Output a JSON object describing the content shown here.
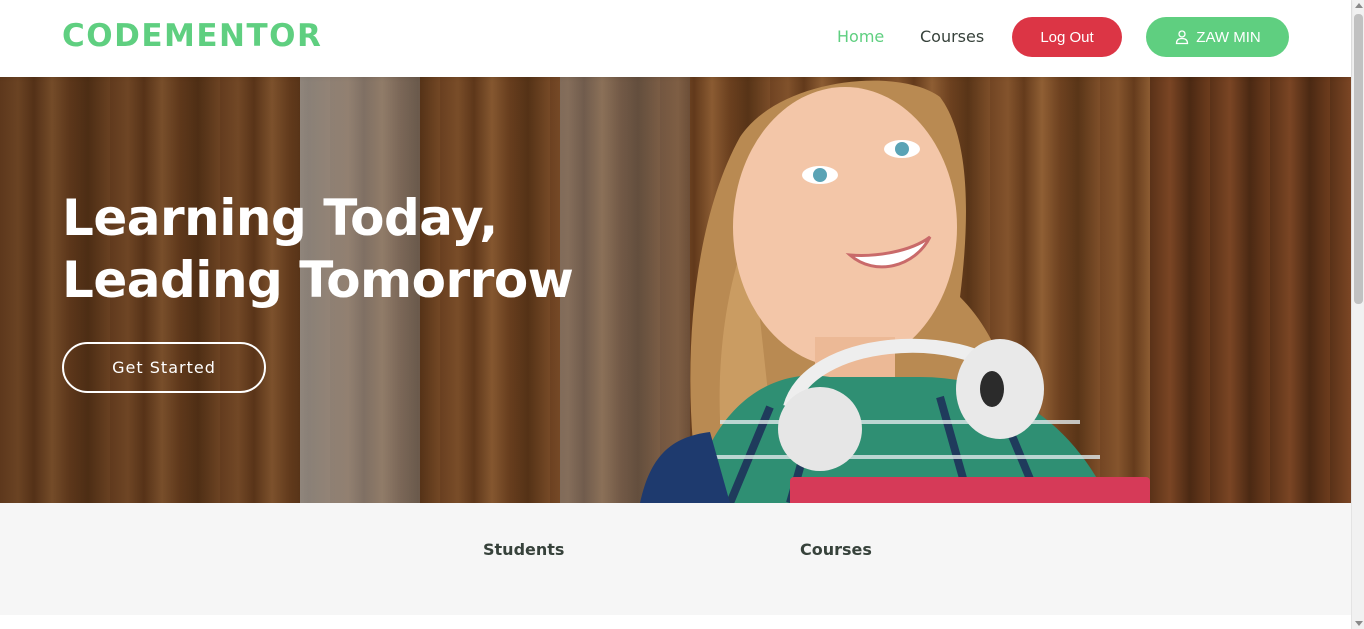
{
  "brand": {
    "name": "CODEMENTOR",
    "color": "#5fcf80"
  },
  "nav": {
    "home_label": "Home",
    "courses_label": "Courses",
    "logout_label": "Log Out",
    "user_label": "ZAW MIN",
    "user_icon": "user-icon",
    "active": "Home"
  },
  "hero": {
    "title_line1": "Learning Today,",
    "title_line2": "Leading Tomorrow",
    "cta_label": "Get Started"
  },
  "stats": {
    "students_label": "Students",
    "courses_label": "Courses"
  },
  "colors": {
    "accent": "#5fcf80",
    "danger": "#dc3545",
    "text_dark": "#37423b",
    "band_bg": "#f6f6f6"
  }
}
